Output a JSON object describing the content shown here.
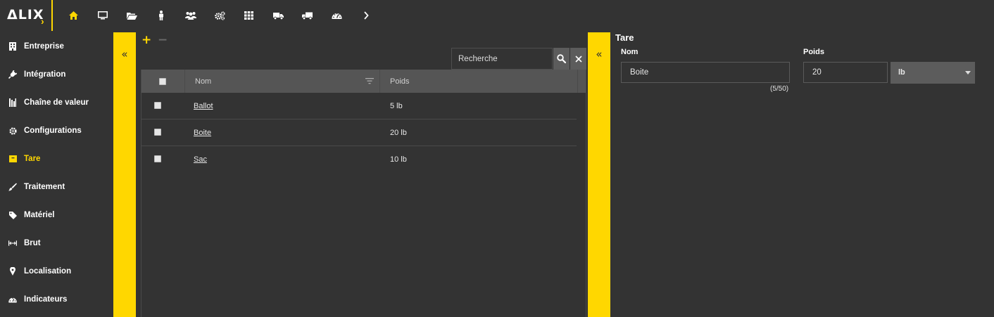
{
  "app": {
    "logo_text": "ΔLIX",
    "accent_color": "#ffd700",
    "background_color": "#333333"
  },
  "topnav": {
    "items": [
      {
        "icon": "home-icon",
        "active": true
      },
      {
        "icon": "monitor-icon"
      },
      {
        "icon": "folder-open-icon"
      },
      {
        "icon": "person-icon"
      },
      {
        "icon": "users-icon"
      },
      {
        "icon": "gears-icon"
      },
      {
        "icon": "grid-icon"
      },
      {
        "icon": "truck-icon"
      },
      {
        "icon": "truck-large-icon"
      },
      {
        "icon": "dashboard-icon"
      },
      {
        "icon": "chevron-right-icon"
      }
    ]
  },
  "sidebar": {
    "items": [
      {
        "label": "Entreprise",
        "icon": "building-icon"
      },
      {
        "label": "Intégration",
        "icon": "plug-icon"
      },
      {
        "label": "Chaîne de valeur",
        "icon": "value-chain-icon"
      },
      {
        "label": "Configurations",
        "icon": "gear-icon"
      },
      {
        "label": "Tare",
        "icon": "box-icon",
        "active": true
      },
      {
        "label": "Traitement",
        "icon": "brush-icon"
      },
      {
        "label": "Matériel",
        "icon": "tag-icon"
      },
      {
        "label": "Brut",
        "icon": "arrows-h-icon"
      },
      {
        "label": "Localisation",
        "icon": "map-marker-icon"
      },
      {
        "label": "Indicateurs",
        "icon": "dashboard-icon"
      }
    ]
  },
  "toolbar": {
    "add_label": "+",
    "remove_label": "−"
  },
  "search": {
    "placeholder": "Recherche",
    "value": ""
  },
  "grid": {
    "columns": [
      "Nom",
      "Poids"
    ],
    "rows": [
      {
        "nom": "Ballot",
        "poids": "5 lb"
      },
      {
        "nom": "Boite",
        "poids": "20 lb"
      },
      {
        "nom": "Sac",
        "poids": "10 lb"
      }
    ]
  },
  "detail": {
    "title": "Tare",
    "nom_label": "Nom",
    "nom_value": "Boite",
    "nom_counter": "(5/50)",
    "poids_label": "Poids",
    "poids_value": "20",
    "unit_value": "lb"
  },
  "collapse_glyph": "«"
}
